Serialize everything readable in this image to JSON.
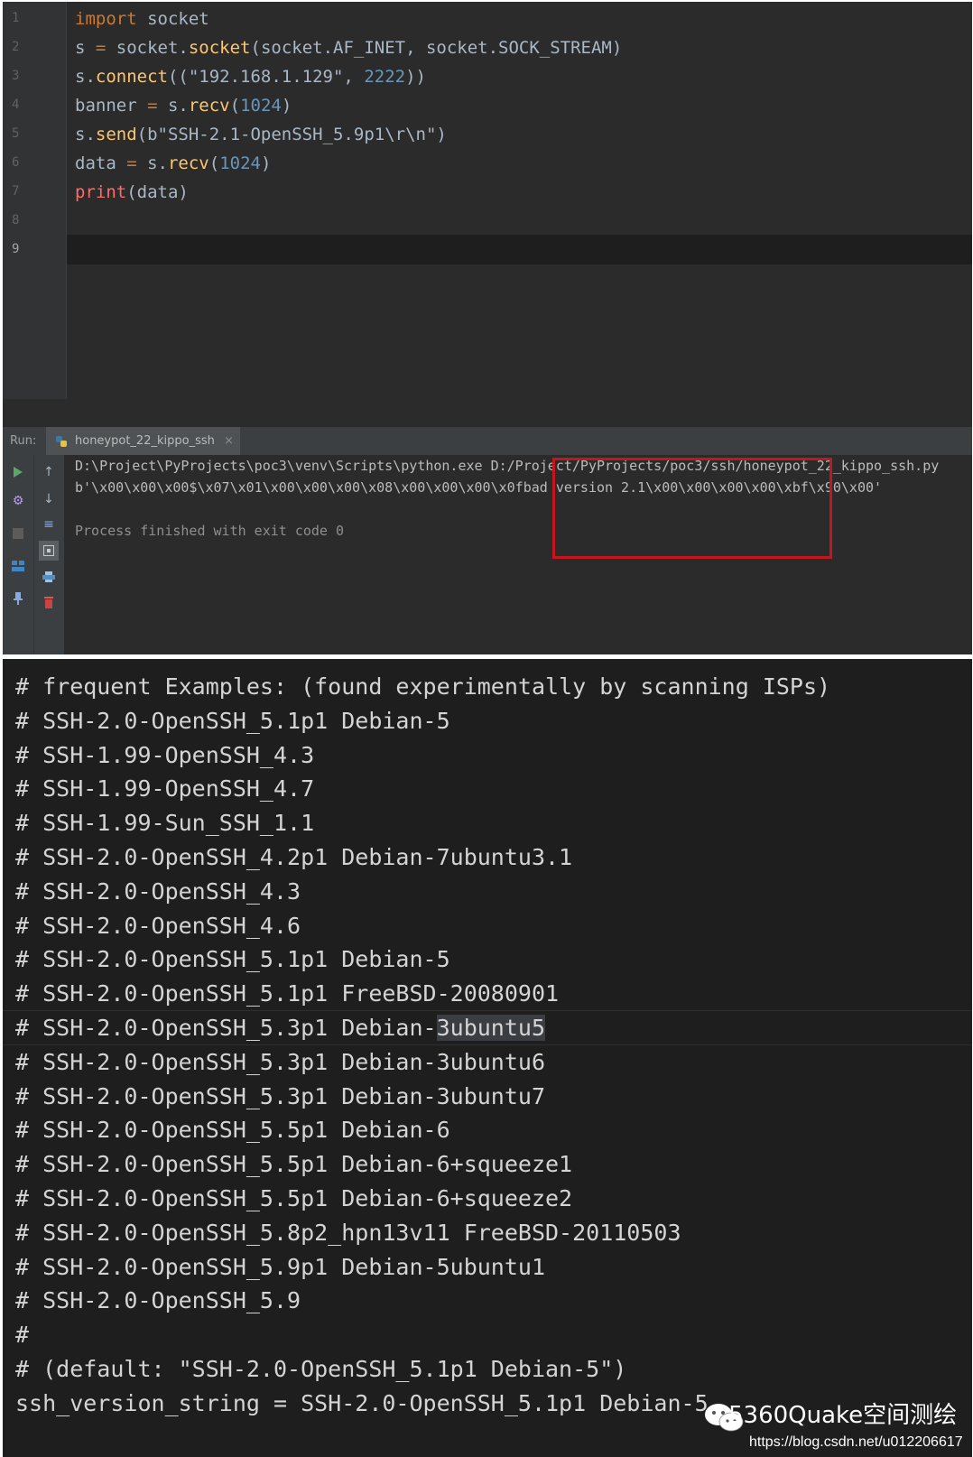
{
  "editor": {
    "line_numbers": [
      "1",
      "2",
      "3",
      "4",
      "5",
      "6",
      "7",
      "8",
      "9"
    ],
    "lines": [
      [
        {
          "t": "import",
          "c": "kw"
        },
        {
          "t": " socket",
          "c": "plain"
        }
      ],
      [
        {
          "t": "s ",
          "c": "plain"
        },
        {
          "t": "=",
          "c": "kw"
        },
        {
          "t": " socket.",
          "c": "plain"
        },
        {
          "t": "socket",
          "c": "fn"
        },
        {
          "t": "(socket.AF_INET, socket.SOCK_STREAM)",
          "c": "plain"
        }
      ],
      [
        {
          "t": "s.",
          "c": "plain"
        },
        {
          "t": "connect",
          "c": "fn"
        },
        {
          "t": "((\"192.168.1.129\", ",
          "c": "plain"
        },
        {
          "t": "2222",
          "c": "num"
        },
        {
          "t": "))",
          "c": "plain"
        }
      ],
      [
        {
          "t": "banner ",
          "c": "plain"
        },
        {
          "t": "=",
          "c": "kw"
        },
        {
          "t": " s.",
          "c": "plain"
        },
        {
          "t": "recv",
          "c": "fn"
        },
        {
          "t": "(",
          "c": "plain"
        },
        {
          "t": "1024",
          "c": "num"
        },
        {
          "t": ")",
          "c": "plain"
        }
      ],
      [
        {
          "t": "s.",
          "c": "plain"
        },
        {
          "t": "send",
          "c": "fn"
        },
        {
          "t": "(b\"SSH-2.1-OpenSSH_5.9p1\\r\\n\")",
          "c": "plain"
        }
      ],
      [
        {
          "t": "data ",
          "c": "plain"
        },
        {
          "t": "=",
          "c": "kw"
        },
        {
          "t": " s.",
          "c": "plain"
        },
        {
          "t": "recv",
          "c": "fn"
        },
        {
          "t": "(",
          "c": "plain"
        },
        {
          "t": "1024",
          "c": "num"
        },
        {
          "t": ")",
          "c": "plain"
        }
      ],
      [
        {
          "t": "print",
          "c": "pr"
        },
        {
          "t": "(data)",
          "c": "plain"
        }
      ],
      [],
      []
    ]
  },
  "run_panel": {
    "label": "Run:",
    "tab_name": "honeypot_22_kippo_ssh",
    "tab_close": "×",
    "output_lines": [
      "D:\\Project\\PyProjects\\poc3\\venv\\Scripts\\python.exe D:/Project/PyProjects/poc3/ssh/honeypot_22_kippo_ssh.py",
      "b'\\x00\\x00\\x00$\\x07\\x01\\x00\\x00\\x00\\x08\\x00\\x00\\x00\\x0fbad version 2.1\\x00\\x00\\x00\\x00\\xbf\\x90\\x00'",
      "",
      "Process finished with exit code 0"
    ]
  },
  "config": {
    "lines": [
      "# frequent Examples: (found experimentally by scanning ISPs)",
      "# SSH-2.0-OpenSSH_5.1p1 Debian-5",
      "# SSH-1.99-OpenSSH_4.3",
      "# SSH-1.99-OpenSSH_4.7",
      "# SSH-1.99-Sun_SSH_1.1",
      "# SSH-2.0-OpenSSH_4.2p1 Debian-7ubuntu3.1",
      "# SSH-2.0-OpenSSH_4.3",
      "# SSH-2.0-OpenSSH_4.6",
      "# SSH-2.0-OpenSSH_5.1p1 Debian-5",
      "# SSH-2.0-OpenSSH_5.1p1 FreeBSD-20080901",
      "# SSH-2.0-OpenSSH_5.3p1 Debian-3ubuntu5",
      "# SSH-2.0-OpenSSH_5.3p1 Debian-3ubuntu6",
      "# SSH-2.0-OpenSSH_5.3p1 Debian-3ubuntu7",
      "# SSH-2.0-OpenSSH_5.5p1 Debian-6",
      "# SSH-2.0-OpenSSH_5.5p1 Debian-6+squeeze1",
      "# SSH-2.0-OpenSSH_5.5p1 Debian-6+squeeze2",
      "# SSH-2.0-OpenSSH_5.8p2_hpn13v11 FreeBSD-20110503",
      "# SSH-2.0-OpenSSH_5.9p1 Debian-5ubuntu1",
      "# SSH-2.0-OpenSSH_5.9",
      "#",
      "# (default: \"SSH-2.0-OpenSSH_5.1p1 Debian-5\")",
      "ssh_version_string = SSH-2.0-OpenSSH_5.1p1 Debian-5"
    ],
    "highlighted_line": 10
  },
  "watermark": {
    "brand": "5360Quake空间测绘",
    "url": "https://blog.csdn.net/u012206617"
  },
  "colors": {
    "keyword": "#cc7832",
    "function": "#ffc66d",
    "number": "#6897bb",
    "print": "#ff6b68",
    "highlight_box": "#c4161c"
  }
}
